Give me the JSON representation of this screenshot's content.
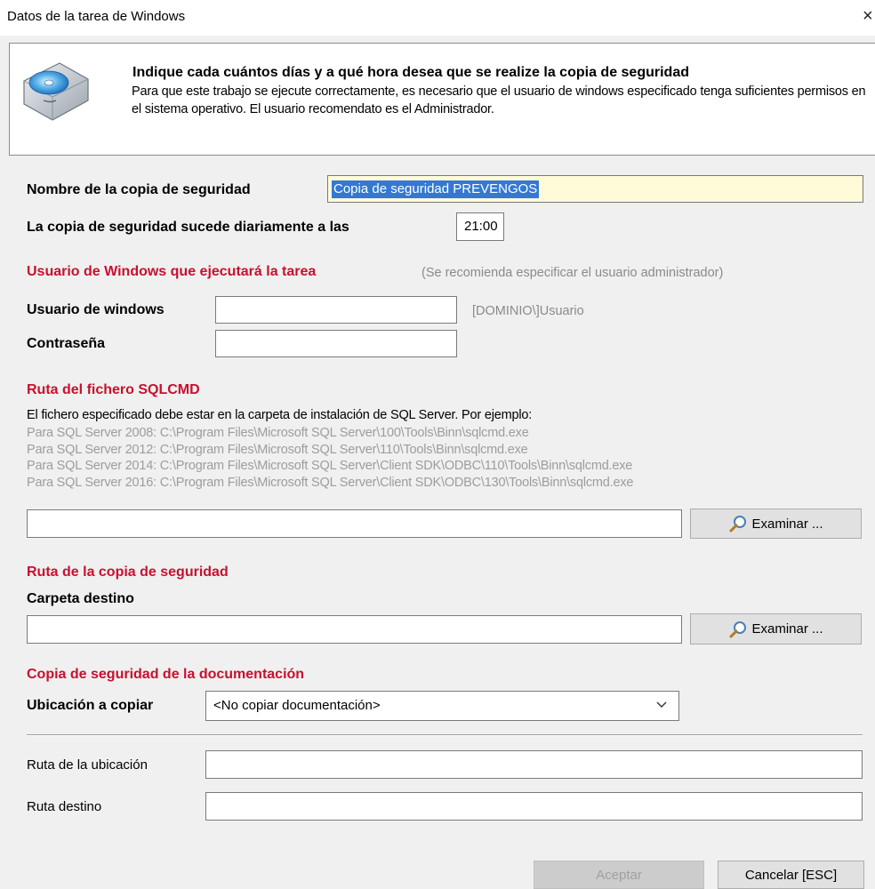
{
  "window": {
    "title": "Datos de la tarea de Windows",
    "close_glyph": "×"
  },
  "header": {
    "icon": "backup-disk-icon",
    "title": "Indique cada cuántos días y a qué hora desea que se realize la copia de seguridad",
    "description": "Para que este trabajo se ejecute correctamente, es necesario que el usuario de windows especificado tenga suficientes permisos en el sistema operativo. El usuario recomendato es el Administrador."
  },
  "backup_name": {
    "label": "Nombre de la copia de seguridad",
    "value": "Copia de seguridad PREVENGOS"
  },
  "schedule": {
    "label": "La copia de seguridad sucede diariamente a las",
    "time": "21:00"
  },
  "windows_user": {
    "section_title": "Usuario de Windows que ejecutará la tarea",
    "section_hint": "(Se recomienda especificar el usuario administrador)",
    "user_label": "Usuario de windows",
    "user_value": "",
    "user_hint": "[DOMINIO\\]Usuario",
    "password_label": "Contraseña",
    "password_value": ""
  },
  "sqlcmd": {
    "section_title": "Ruta del fichero SQLCMD",
    "description": "El fichero especificado debe estar en la carpeta de instalación de SQL Server. Por ejemplo:",
    "examples": [
      "Para SQL Server 2008: C:\\Program Files\\Microsoft SQL Server\\100\\Tools\\Binn\\sqlcmd.exe",
      "Para SQL Server 2012: C:\\Program Files\\Microsoft SQL Server\\110\\Tools\\Binn\\sqlcmd.exe",
      "Para SQL Server 2014: C:\\Program Files\\Microsoft SQL Server\\Client SDK\\ODBC\\110\\Tools\\Binn\\sqlcmd.exe",
      "Para SQL Server 2016: C:\\Program Files\\Microsoft SQL Server\\Client SDK\\ODBC\\130\\Tools\\Binn\\sqlcmd.exe"
    ],
    "path_value": "",
    "browse_label": "Examinar ..."
  },
  "backup_path": {
    "section_title": "Ruta de la copia de seguridad",
    "folder_label": "Carpeta destino",
    "path_value": "",
    "browse_label": "Examinar ..."
  },
  "documentation": {
    "section_title": "Copia de seguridad de la documentación",
    "location_label": "Ubicación a copiar",
    "location_selected": "<No copiar documentación>",
    "location_path_label": "Ruta de la ubicación",
    "location_path_value": "",
    "dest_path_label": "Ruta destino",
    "dest_path_value": ""
  },
  "footer": {
    "accept_label": "Aceptar",
    "cancel_label": "Cancelar [ESC]"
  },
  "colors": {
    "section_red": "#c8102e",
    "selection_blue": "#3478d4",
    "highlight_yellow": "#fffbd9"
  }
}
